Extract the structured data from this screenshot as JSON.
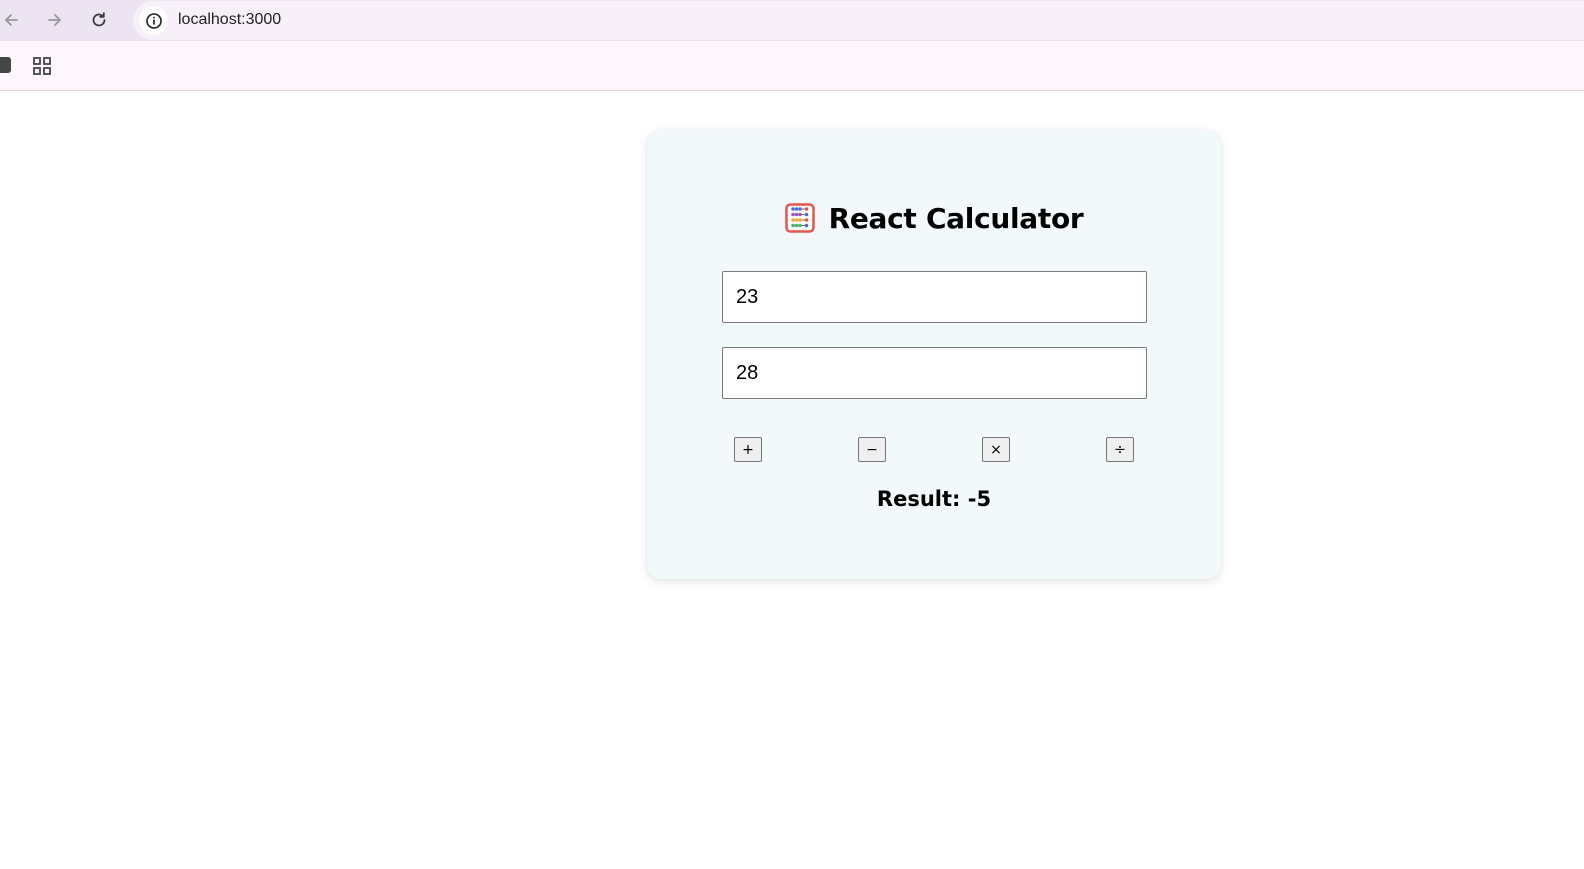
{
  "browser": {
    "url": "localhost:3000",
    "icons": {
      "back": "back-arrow-icon",
      "forward": "forward-arrow-icon",
      "reload": "reload-icon",
      "site_info": "info-icon",
      "apps": "apps-grid-icon"
    }
  },
  "calculator": {
    "title": "React Calculator",
    "title_icon": "abacus-icon",
    "input_a": {
      "value": "23"
    },
    "input_b": {
      "value": "28"
    },
    "operations": {
      "add": "+",
      "subtract": "−",
      "multiply": "×",
      "divide": "÷"
    },
    "result_label": "Result: -5"
  },
  "colors": {
    "chrome_bar": "#ede4f1",
    "bookmarks_bar": "#fdf6fd",
    "card_background": "#f3f8fa"
  }
}
